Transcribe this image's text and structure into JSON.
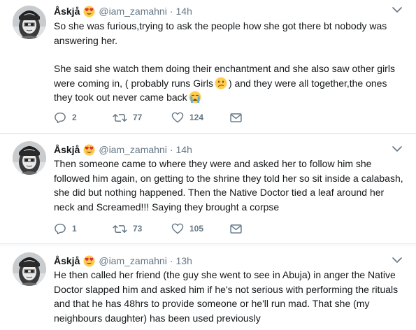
{
  "tweets": [
    {
      "name": "Åskjå",
      "name_emoji": "heart-eyes-emoji",
      "handle": "@iam_zamahni",
      "dot": "·",
      "time": "14h",
      "para1_a": "So she was furious,trying to ask the people how she got there bt nobody was answering her.",
      "para2_a": "She said she watch them doing their enchantment and she also saw other girls were coming in, ( probably runs Girls",
      "para2_emoji": "confused-face-emoji",
      "para2_b": ") and they were all together,the ones they took out never came back",
      "para2_end_emoji": "crying-face-emoji",
      "replies": "2",
      "retweets": "77",
      "likes": "124"
    },
    {
      "name": "Åskjå",
      "name_emoji": "heart-eyes-emoji",
      "handle": "@iam_zamahni",
      "dot": "·",
      "time": "14h",
      "text": "Then someone came to where they were and asked her to follow him she followed him again, on getting to the shrine they told her so sit inside a calabash, she did but nothing happened. Then the Native Doctor tied a leaf around her neck and Screamed!!! Saying they brought a corpse",
      "replies": "1",
      "retweets": "73",
      "likes": "105"
    },
    {
      "name": "Åskjå",
      "name_emoji": "heart-eyes-emoji",
      "handle": "@iam_zamahni",
      "dot": "·",
      "time": "13h",
      "text": "He then called her friend (the guy she went to see in Abuja) in anger the Native Doctor slapped him and asked him if he's not serious with performing the rituals and that he has 48hrs to provide someone or he'll run mad. That she (my neighbours daughter) has been used previously"
    }
  ],
  "colors": {
    "text": "#14171a",
    "muted": "#657786",
    "divider": "#e6ecf0"
  }
}
